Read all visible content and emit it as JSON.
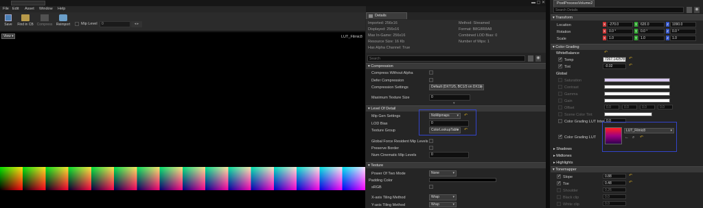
{
  "menu": [
    "File",
    "Edit",
    "Asset",
    "Window",
    "Help"
  ],
  "toolbar": {
    "save": "Save",
    "find": "Find in CB",
    "compress": "Compress",
    "reimport": "Reimport",
    "mip_label": "Mip Level",
    "mip_value": "0"
  },
  "viewport": {
    "view_btn": "View",
    "name": "LUT_Filmic8"
  },
  "details_tab": "Details",
  "info": {
    "left": [
      "Imported: 256x16",
      "Displayed: 256x16",
      "Max In-Game: 256x16",
      "Resource Size: 16 Kb",
      "Has Alpha Channel: True"
    ],
    "right": [
      "Method: Streamed",
      "Format: B8G8R8A8",
      "Combined LOD Bias: 0",
      "Number of Mips: 1"
    ]
  },
  "search_placeholder": "Search",
  "sections": {
    "compression": "Compression",
    "lod": "Level Of Detail",
    "texture": "Texture"
  },
  "compression_rows": [
    {
      "label": "Compress Without Alpha"
    },
    {
      "label": "Defer Compression"
    },
    {
      "label": "Compression Settings",
      "value": "Default (DXT1/5, BC1/3 on DX11)"
    },
    {
      "label": "Maximum Texture Size",
      "value": "0"
    }
  ],
  "lod_rows": [
    {
      "label": "Mip Gen Settings",
      "value": "NoMipmaps"
    },
    {
      "label": "LOD Bias",
      "value": "0"
    },
    {
      "label": "Texture Group",
      "value": "ColorLookupTable"
    },
    {
      "label": "Global Force Resident Mip Levels"
    },
    {
      "label": "Preserve Border"
    },
    {
      "label": "Num Cinematic Mip Levels",
      "value": "0"
    }
  ],
  "texture_rows": [
    {
      "label": "Power Of Two Mode",
      "value": "None"
    },
    {
      "label": "Padding Color"
    },
    {
      "label": "sRGB"
    },
    {
      "label": "X-axis Tiling Method",
      "value": "Wrap"
    },
    {
      "label": "Y-axis Tiling Method",
      "value": "Wrap"
    }
  ],
  "right": {
    "tab": "PostProcessVolume2",
    "search_placeholder": "Search Details",
    "transform": "Transform",
    "location": {
      "label": "Location",
      "x": "-270.0",
      "y": "620.0",
      "z": "1090.0"
    },
    "rotation": {
      "label": "Rotation",
      "x": "0.0 °",
      "y": "0.0 °",
      "z": "0.0 °"
    },
    "scale": {
      "label": "Scale",
      "x": "1.0",
      "y": "1.0",
      "z": "1.0"
    },
    "color_grading": "Color Grading",
    "white_balance": "WhiteBalance",
    "temp": {
      "label": "Temp",
      "value": "7267.142578"
    },
    "tint": {
      "label": "Tint",
      "value": "-0.02"
    },
    "global": "Global",
    "global_rows": [
      "Saturation",
      "Contrast",
      "Gamma",
      "Gain",
      "Offset"
    ],
    "offset_vals": [
      "0.0",
      "0.0",
      "0.0",
      "0.0"
    ],
    "scene_color_tint": "Scene Color Tint",
    "cg_intensity": {
      "label": "Color Grading LUT Intensity",
      "value": "0.0"
    },
    "cg_lut": {
      "label": "Color Grading LUT",
      "asset": "LUT_Filmic8"
    },
    "collapsed": [
      "Shadows",
      "Midtones",
      "Highlights"
    ],
    "tonemapper": "Tonemapper",
    "tone_rows": [
      {
        "label": "Slope",
        "value": "0.88"
      },
      {
        "label": "Toe",
        "value": "0.48"
      },
      {
        "label": "Shoulder",
        "value": "0.26"
      },
      {
        "label": "Black clip",
        "value": "0.0"
      },
      {
        "label": "White clip",
        "value": "0.0"
      }
    ]
  }
}
